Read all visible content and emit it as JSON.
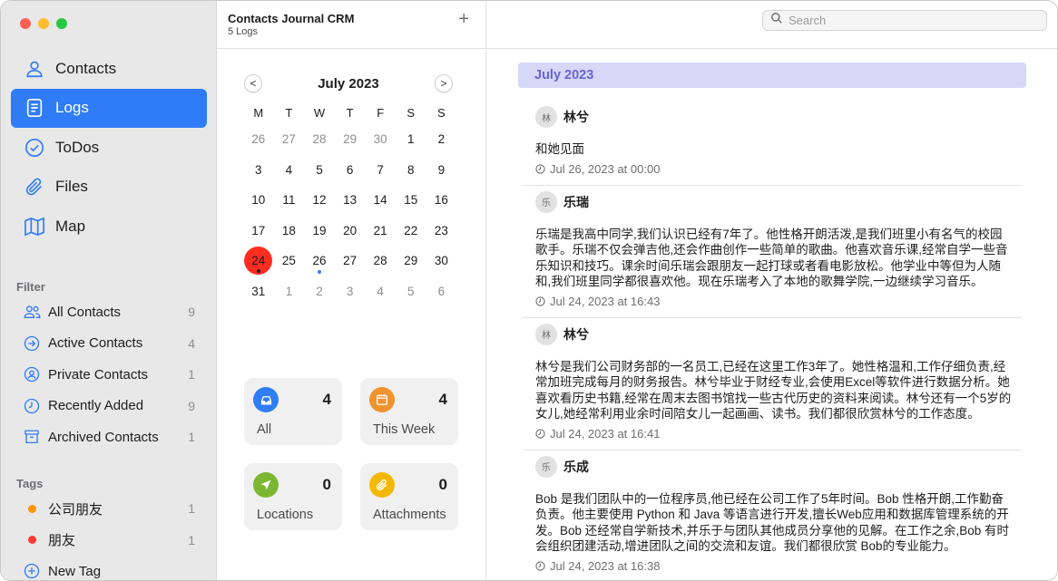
{
  "window": {
    "traffic_lights": [
      "close",
      "minimize",
      "maximize"
    ]
  },
  "sidebar": {
    "nav": [
      {
        "label": "Contacts",
        "icon": "person-icon",
        "active": false
      },
      {
        "label": "Logs",
        "icon": "document-icon",
        "active": true
      },
      {
        "label": "ToDos",
        "icon": "checkmark-circle-icon",
        "active": false
      },
      {
        "label": "Files",
        "icon": "paperclip-icon",
        "active": false
      },
      {
        "label": "Map",
        "icon": "map-icon",
        "active": false
      }
    ],
    "filter_title": "Filter",
    "filters": [
      {
        "label": "All Contacts",
        "count": "9",
        "icon": "people-icon"
      },
      {
        "label": "Active Contacts",
        "count": "4",
        "icon": "arrow-circle-icon"
      },
      {
        "label": "Private Contacts",
        "count": "1",
        "icon": "person-circle-icon"
      },
      {
        "label": "Recently Added",
        "count": "9",
        "icon": "clock-icon"
      },
      {
        "label": "Archived Contacts",
        "count": "1",
        "icon": "archive-box-icon"
      }
    ],
    "tags_title": "Tags",
    "tags": [
      {
        "label": "公司朋友",
        "count": "1",
        "color": "#ff9500"
      },
      {
        "label": "朋友",
        "count": "1",
        "color": "#ff3b30"
      }
    ],
    "new_tag": {
      "label": "New Tag",
      "icon": "plus-circle-icon"
    }
  },
  "middle": {
    "title": "Contacts Journal CRM",
    "subtitle": "5 Logs",
    "add_label": "+",
    "calendar": {
      "month": "July 2023",
      "prev": "<",
      "next": ">",
      "weekdays": [
        "M",
        "T",
        "W",
        "T",
        "F",
        "S",
        "S"
      ],
      "days": [
        {
          "d": "26",
          "muted": true
        },
        {
          "d": "27",
          "muted": true
        },
        {
          "d": "28",
          "muted": true
        },
        {
          "d": "29",
          "muted": true
        },
        {
          "d": "30",
          "muted": true
        },
        {
          "d": "1"
        },
        {
          "d": "2"
        },
        {
          "d": "3"
        },
        {
          "d": "4"
        },
        {
          "d": "5"
        },
        {
          "d": "6"
        },
        {
          "d": "7"
        },
        {
          "d": "8"
        },
        {
          "d": "9"
        },
        {
          "d": "10"
        },
        {
          "d": "11"
        },
        {
          "d": "12"
        },
        {
          "d": "13"
        },
        {
          "d": "14"
        },
        {
          "d": "15"
        },
        {
          "d": "16"
        },
        {
          "d": "17"
        },
        {
          "d": "18"
        },
        {
          "d": "19"
        },
        {
          "d": "20"
        },
        {
          "d": "21"
        },
        {
          "d": "22"
        },
        {
          "d": "23"
        },
        {
          "d": "24",
          "today": true,
          "mark": true
        },
        {
          "d": "25"
        },
        {
          "d": "26",
          "mark": true
        },
        {
          "d": "27"
        },
        {
          "d": "28"
        },
        {
          "d": "29"
        },
        {
          "d": "30"
        },
        {
          "d": "31"
        },
        {
          "d": "1",
          "muted": true
        },
        {
          "d": "2",
          "muted": true
        },
        {
          "d": "3",
          "muted": true
        },
        {
          "d": "4",
          "muted": true
        },
        {
          "d": "5",
          "muted": true
        },
        {
          "d": "6",
          "muted": true
        }
      ]
    },
    "cards": [
      {
        "label": "All",
        "count": "4",
        "icon": "tray-icon",
        "color": "#2f7cf6"
      },
      {
        "label": "This Week",
        "count": "4",
        "icon": "calendar-icon",
        "color": "#f0922e"
      },
      {
        "label": "Locations",
        "count": "0",
        "icon": "location-arrow-icon",
        "color": "#7cb732"
      },
      {
        "label": "Attachments",
        "count": "0",
        "icon": "paperclip-icon",
        "color": "#f5b800"
      }
    ]
  },
  "right": {
    "search": {
      "placeholder": "Search"
    },
    "month_header": "July 2023",
    "entries": [
      {
        "avatar": "林",
        "name": "林兮",
        "body": "和她见面",
        "time": "Jul 26, 2023 at 00:00"
      },
      {
        "avatar": "乐",
        "name": "乐瑞",
        "body": "乐瑞是我高中同学,我们认识已经有7年了。他性格开朗活泼,是我们班里小有名气的校园歌手。乐瑞不仅会弹吉他,还会作曲创作一些简单的歌曲。他喜欢音乐课,经常自学一些音乐知识和技巧。课余时间乐瑞会跟朋友一起打球或者看电影放松。他学业中等但为人随和,我们班里同学都很喜欢他。现在乐瑞考入了本地的歌舞学院,一边继续学习音乐。",
        "time": "Jul 24, 2023 at 16:43"
      },
      {
        "avatar": "林",
        "name": "林兮",
        "body": "林兮是我们公司财务部的一名员工,已经在这里工作3年了。她性格温和,工作仔细负责,经常加班完成每月的财务报告。林兮毕业于财经专业,会使用Excel等软件进行数据分析。她喜欢看历史书籍,经常在周末去图书馆找一些古代历史的资料来阅读。林兮还有一个5岁的女儿,她经常利用业余时间陪女儿一起画画、读书。我们都很欣赏林兮的工作态度。",
        "time": "Jul 24, 2023 at 16:41"
      },
      {
        "avatar": "乐",
        "name": "乐成",
        "body": "Bob 是我们团队中的一位程序员,他已经在公司工作了5年时间。Bob 性格开朗,工作勤奋负责。他主要使用 Python 和 Java 等语言进行开发,擅长Web应用和数据库管理系统的开发。Bob 还经常自学新技术,并乐于与团队其他成员分享他的见解。在工作之余,Bob 有时会组织团建活动,增进团队之间的交流和友谊。我们都很欣赏 Bob的专业能力。",
        "time": "Jul 24, 2023 at 16:38"
      }
    ]
  }
}
